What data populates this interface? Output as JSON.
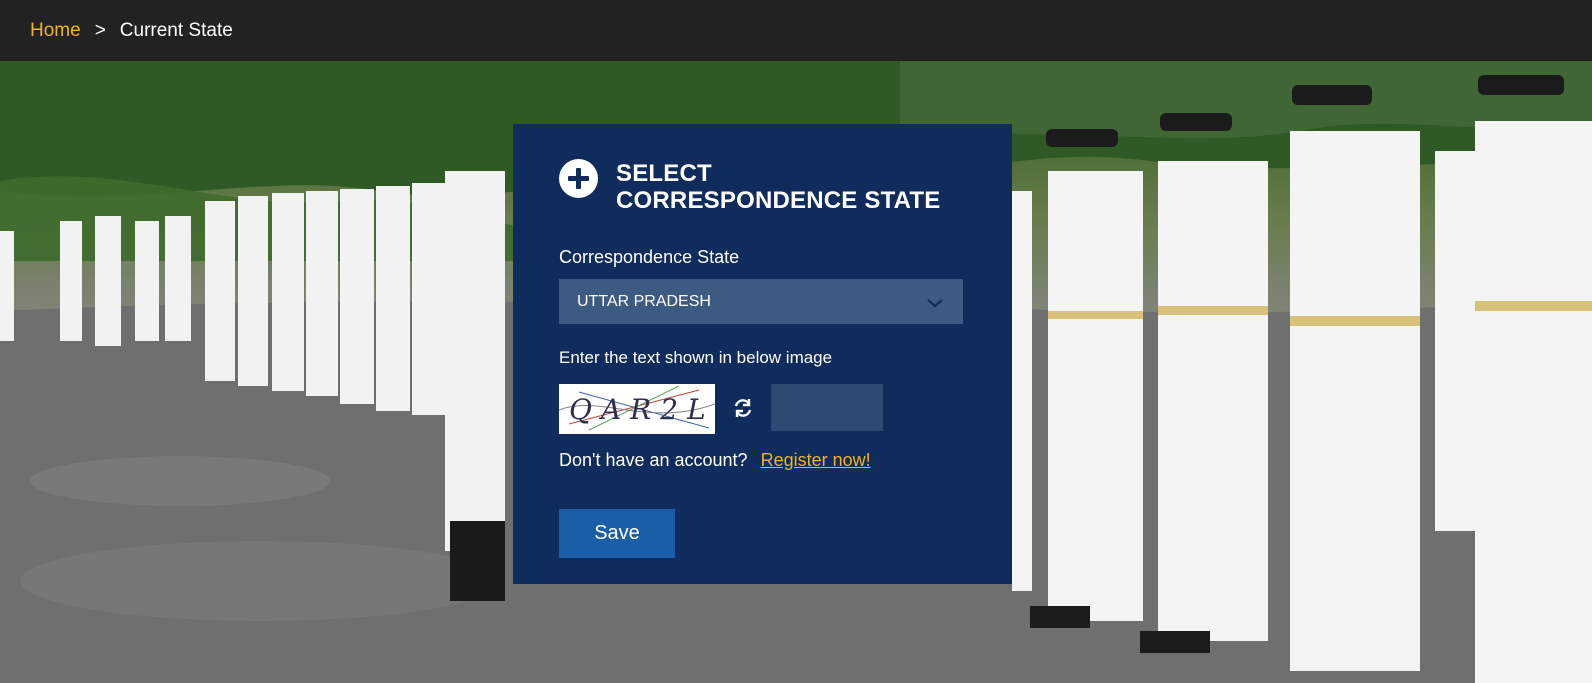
{
  "breadcrumb": {
    "home": "Home",
    "separator": ">",
    "current": "Current State"
  },
  "dialog": {
    "icon": "plus-circle-icon",
    "title_line1": "SELECT",
    "title_line2": "CORRESPONDENCE STATE",
    "state_label": "Correspondence State",
    "state_value": "UTTAR PRADESH",
    "captcha_label": "Enter the text shown in below image",
    "captcha_text": "QAR2L",
    "captcha_input_value": "",
    "account_prompt": "Don't have an account?",
    "register_link": "Register now!",
    "save_label": "Save"
  },
  "colors": {
    "topbar_bg": "#222222",
    "accent_yellow": "#f2b21f",
    "dialog_bg": "#0f2c5c",
    "select_bg": "#3c5a82",
    "button_bg": "#1a5ea8"
  }
}
